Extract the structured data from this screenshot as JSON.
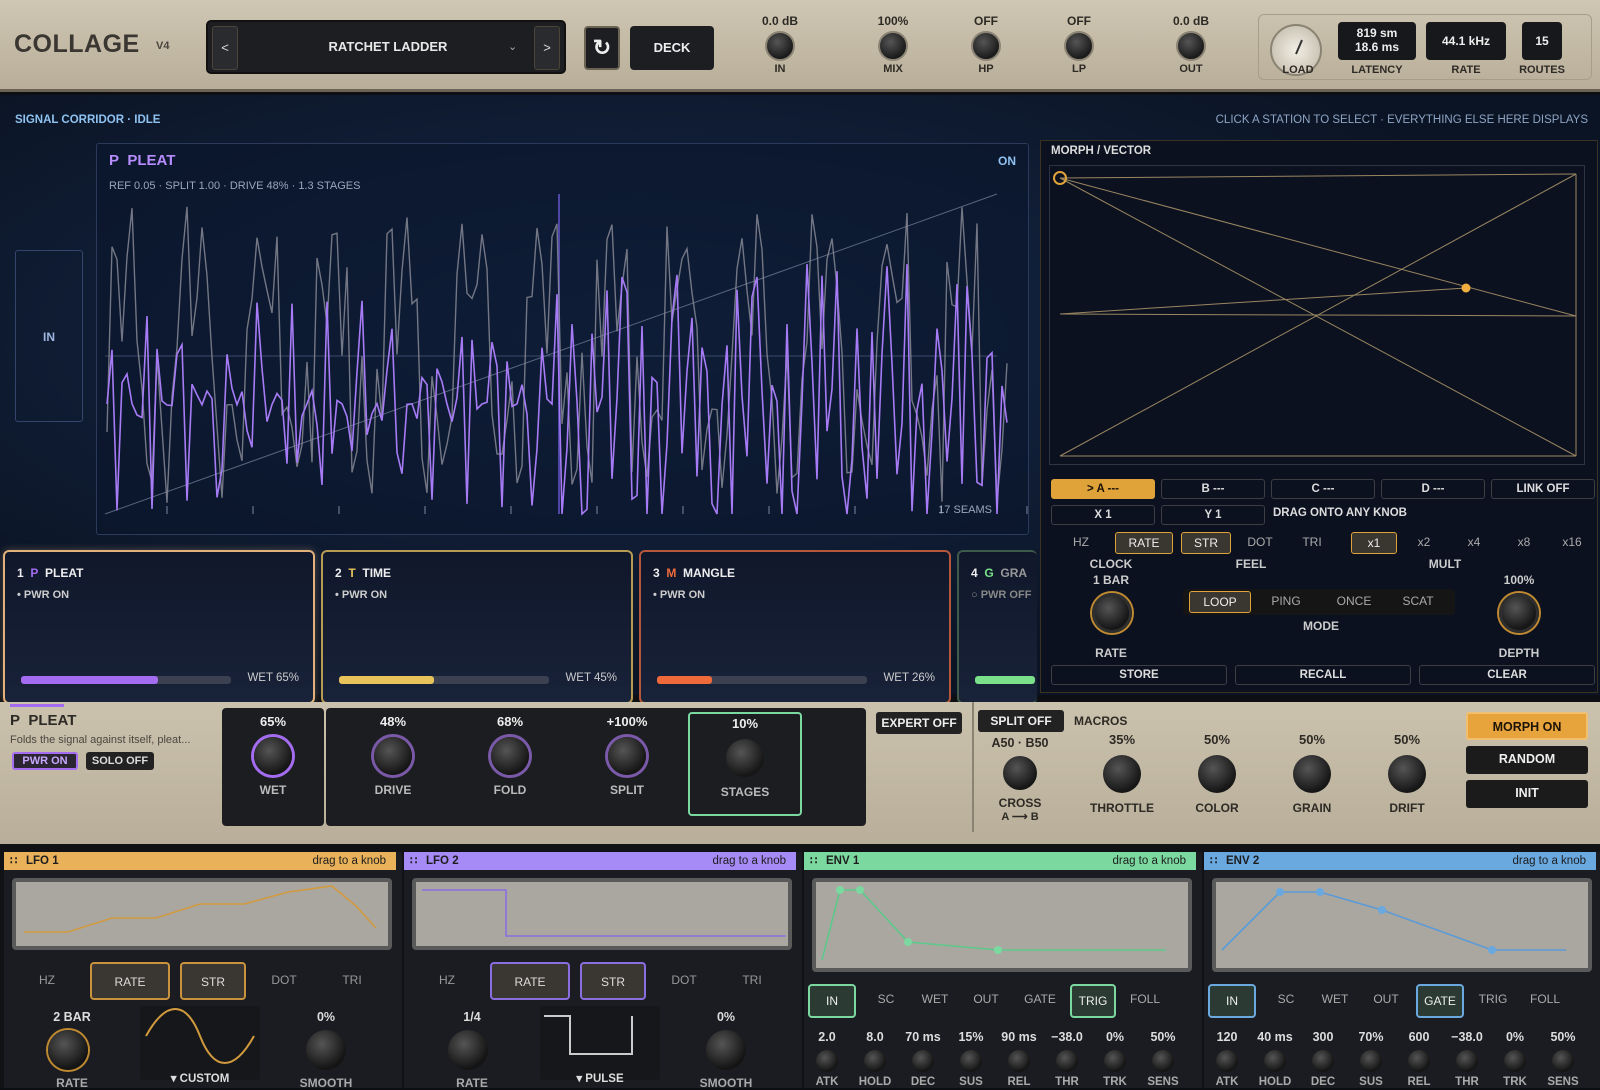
{
  "header": {
    "logo": "COLLAGE",
    "version": "V4",
    "prev_label": "<",
    "next_label": ">",
    "preset_name": "RATCHET LADDER",
    "preset_dropdown": "⌄",
    "refresh_icon": "↻",
    "deck_label": "DECK",
    "knobs": [
      {
        "value": "0.0 dB",
        "label": "IN"
      },
      {
        "value": "100%",
        "label": "MIX"
      },
      {
        "value": "OFF",
        "label": "HP"
      },
      {
        "value": "OFF",
        "label": "LP"
      },
      {
        "value": "0.0 dB",
        "label": "OUT"
      }
    ],
    "load_label": "LOAD",
    "latency_1": "819 sm",
    "latency_2": "18.6 ms",
    "latency_label": "LATENCY",
    "rate_value": "44.1 kHz",
    "rate_label": "RATE",
    "routes_value": "15",
    "routes_label": "ROUTES"
  },
  "corridor": {
    "title": "SIGNAL CORRIDOR · IDLE",
    "hint": "CLICK A STATION TO SELECT · EVERYTHING ELSE HERE DISPLAYS",
    "in_label": "IN",
    "station_letter": "P",
    "station_name": "PLEAT",
    "state": "ON",
    "params": "REF 0.05 · SPLIT 1.00 · DRIVE 48% · 1.3 STAGES",
    "seams": "17 SEAMS"
  },
  "morph": {
    "title": "MORPH / VECTOR",
    "slots": [
      ">  A ---",
      "B ---",
      "C ---",
      "D ---"
    ],
    "link": "LINK  OFF",
    "x_label": "X 1",
    "y_label": "Y 1",
    "drag_hint": "DRAG ONTO ANY KNOB",
    "clock_opts": [
      "HZ",
      "RATE",
      "STR",
      "DOT",
      "TRI"
    ],
    "mult_opts": [
      "x1",
      "x2",
      "x4",
      "x8",
      "x16"
    ],
    "clock_label": "CLOCK",
    "feel_label": "FEEL",
    "mult_label": "MULT",
    "rate_value": "1 BAR",
    "rate_label": "RATE",
    "modes": [
      "LOOP",
      "PING",
      "ONCE",
      "SCAT"
    ],
    "mode_label": "MODE",
    "depth_value": "100%",
    "depth_label": "DEPTH",
    "store": "STORE",
    "recall": "RECALL",
    "clear": "CLEAR",
    "accent": "#e0a33a"
  },
  "stations": [
    {
      "num": "1",
      "letter": "P",
      "name": "PLEAT",
      "pwr": "• PWR ON",
      "wet": "WET 65%",
      "wet_value": 0.65,
      "color": "#a46cf0"
    },
    {
      "num": "2",
      "letter": "T",
      "name": "TIME",
      "pwr": "• PWR ON",
      "wet": "WET 45%",
      "wet_value": 0.45,
      "color": "#e8c25a"
    },
    {
      "num": "3",
      "letter": "M",
      "name": "MANGLE",
      "pwr": "• PWR ON",
      "wet": "WET 26%",
      "wet_value": 0.26,
      "color": "#ee6a3a"
    },
    {
      "num": "4",
      "letter": "G",
      "name": "GRA",
      "pwr": "○ PWR OFF",
      "color": "#7ae08a"
    }
  ],
  "editor": {
    "letter": "P",
    "name": "PLEAT",
    "desc": "Folds the signal against itself, pleat...",
    "pwr": "PWR  ON",
    "solo": "SOLO  OFF",
    "wet": {
      "value": "65%",
      "label": "WET"
    },
    "knobs": [
      {
        "value": "48%",
        "label": "DRIVE"
      },
      {
        "value": "68%",
        "label": "FOLD"
      },
      {
        "value": "+100%",
        "label": "SPLIT"
      },
      {
        "value": "10%",
        "label": "STAGES"
      }
    ],
    "expert": "EXPERT  OFF",
    "split": "SPLIT  OFF",
    "macros_label": "MACROS",
    "cross_value": "A50 · B50",
    "cross_label": "CROSS",
    "cross_ab": "A ⟶ B",
    "macros": [
      {
        "value": "35%",
        "label": "THROTTLE"
      },
      {
        "value": "50%",
        "label": "COLOR"
      },
      {
        "value": "50%",
        "label": "GRAIN"
      },
      {
        "value": "50%",
        "label": "DRIFT"
      }
    ],
    "morph_on": "MORPH  ON",
    "random": "RANDOM",
    "init": "INIT"
  },
  "mods": {
    "drag_hint": "drag to a knob",
    "lfo1": {
      "title": "LFO 1",
      "color": "#e8b15a",
      "opts": [
        "HZ",
        "RATE",
        "STR",
        "DOT",
        "TRI"
      ],
      "rate_value": "2 BAR",
      "rate_label": "RATE",
      "shape": "▾ CUSTOM",
      "smooth_value": "0%",
      "smooth_label": "SMOOTH"
    },
    "lfo2": {
      "title": "LFO 2",
      "color": "#a68af5",
      "opts": [
        "HZ",
        "RATE",
        "STR",
        "DOT",
        "TRI"
      ],
      "rate_value": "1/4",
      "rate_label": "RATE",
      "shape": "▾ PULSE",
      "smooth_value": "0%",
      "smooth_label": "SMOOTH"
    },
    "env1": {
      "title": "ENV 1",
      "color": "#7bd9a0",
      "opts": [
        "IN",
        "SC",
        "WET",
        "OUT",
        "GATE",
        "TRIG",
        "FOLL"
      ],
      "values": [
        "2.0",
        "8.0",
        "70 ms",
        "15%",
        "90 ms",
        "−38.0",
        "0%",
        "50%"
      ],
      "labels": [
        "ATK",
        "HOLD",
        "DEC",
        "SUS",
        "REL",
        "THR",
        "TRK",
        "SENS"
      ]
    },
    "env2": {
      "title": "ENV 2",
      "color": "#6aa8e0",
      "opts": [
        "IN",
        "SC",
        "WET",
        "OUT",
        "GATE",
        "TRIG",
        "FOLL"
      ],
      "values": [
        "120",
        "40 ms",
        "300",
        "70%",
        "600",
        "−38.0",
        "0%",
        "50%"
      ],
      "labels": [
        "ATK",
        "HOLD",
        "DEC",
        "SUS",
        "REL",
        "THR",
        "TRK",
        "SENS"
      ]
    }
  }
}
